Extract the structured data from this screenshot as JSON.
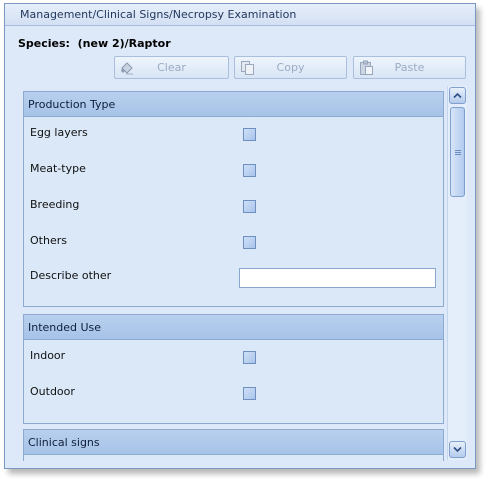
{
  "window": {
    "title": "Management/Clinical Signs/Necropsy Examination"
  },
  "species": {
    "label": "Species:",
    "value": "(new 2)/Raptor"
  },
  "toolbar": {
    "clear_label": "Clear",
    "copy_label": "Copy",
    "paste_label": "Paste",
    "enabled": false
  },
  "sections": {
    "production_type": {
      "header": "Production Type",
      "items": [
        {
          "label": "Egg layers",
          "checked": false
        },
        {
          "label": "Meat-type",
          "checked": false
        },
        {
          "label": "Breeding",
          "checked": false
        },
        {
          "label": "Others",
          "checked": false
        }
      ],
      "describe_other": {
        "label": "Describe other",
        "value": ""
      }
    },
    "intended_use": {
      "header": "Intended Use",
      "items": [
        {
          "label": "Indoor",
          "checked": false
        },
        {
          "label": "Outdoor",
          "checked": false
        }
      ]
    },
    "clinical_signs": {
      "header": "Clinical signs"
    }
  },
  "icons": {
    "clear": "eraser-icon",
    "copy": "copy-icon",
    "paste": "paste-icon",
    "scroll_up": "chevron-up-icon",
    "scroll_down": "chevron-down-icon"
  },
  "colors": {
    "panel_background": "#dde9f8",
    "section_header": "#a6c3e8",
    "border": "#8eaad0"
  }
}
